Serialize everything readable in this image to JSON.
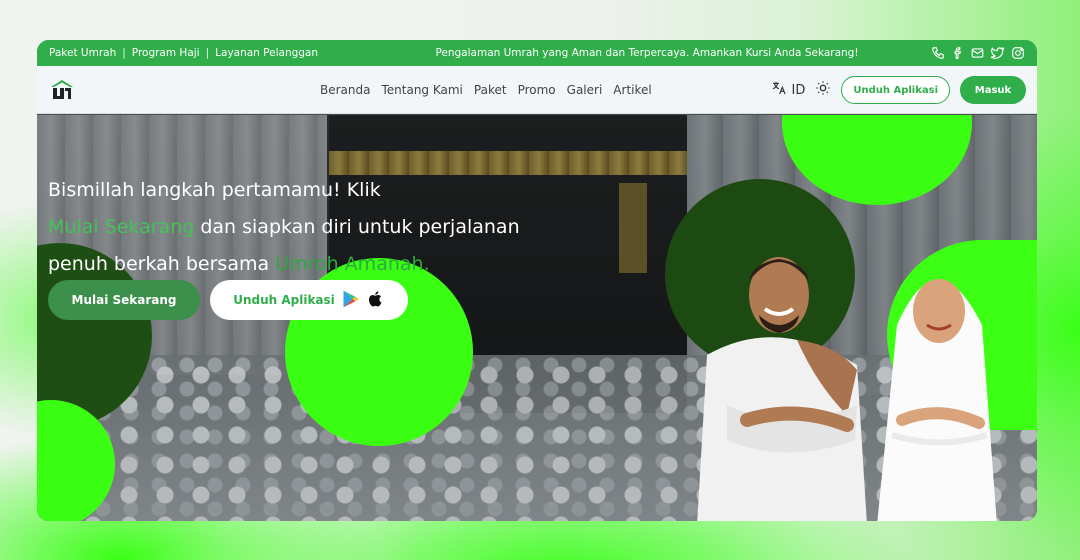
{
  "topbar": {
    "links": [
      "Paket Umrah",
      "Program Haji",
      "Layanan Pelanggan"
    ],
    "separator": "|",
    "tagline": "Pengalaman Umrah yang Aman dan Terpercaya. Amankan Kursi Anda Sekarang!",
    "social_icons": [
      "phone-icon",
      "facebook-icon",
      "mail-icon",
      "twitter-icon",
      "instagram-icon"
    ]
  },
  "nav": {
    "menu": [
      "Beranda",
      "Tentang Kami",
      "Paket",
      "Promo",
      "Galeri",
      "Artikel"
    ],
    "language": "ID",
    "download_label": "Unduh Aplikasi",
    "login_label": "Masuk"
  },
  "hero": {
    "line1": "Bismillah langkah pertamamu! Klik",
    "line2_highlight": "Mulai Sekarang",
    "line2_rest": " dan siapkan diri untuk perjalanan",
    "line3_start": "penuh berkah bersama ",
    "line3_highlight": "Umroh Amanah.",
    "cta_primary": "Mulai Sekarang",
    "cta_secondary": "Unduh Aplikasi"
  },
  "colors": {
    "brand_green": "#2fae4a",
    "accent_lime": "#3bff12",
    "dark_green": "#1d4a12"
  }
}
